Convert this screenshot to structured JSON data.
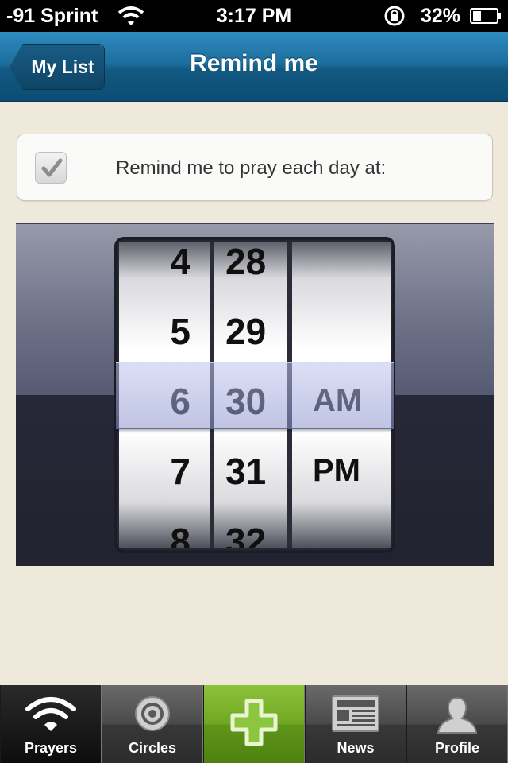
{
  "status_bar": {
    "carrier": "-91 Sprint",
    "time": "3:17 PM",
    "battery_percent": "32%",
    "icons": [
      "wifi-icon",
      "rotation-lock-icon",
      "battery-icon"
    ]
  },
  "nav": {
    "back_label": "My List",
    "title": "Remind me"
  },
  "reminder": {
    "checked": true,
    "label": "Remind me to pray each day at:"
  },
  "picker": {
    "hours": [
      "4",
      "5",
      "6",
      "7",
      "8"
    ],
    "minutes": [
      "28",
      "29",
      "30",
      "31",
      "32"
    ],
    "ampm": [
      "AM",
      "PM"
    ],
    "selected": {
      "hour": "6",
      "minute": "30",
      "ampm": "AM"
    }
  },
  "tab_bar": {
    "tabs": [
      {
        "label": "Prayers",
        "icon": "wifi-signal-icon",
        "active": true
      },
      {
        "label": "Circles",
        "icon": "target-icon",
        "active": false
      },
      {
        "label": "",
        "icon": "plus-icon",
        "active": false
      },
      {
        "label": "News",
        "icon": "newspaper-icon",
        "active": false
      },
      {
        "label": "Profile",
        "icon": "person-icon",
        "active": false
      }
    ]
  },
  "colors": {
    "nav_blue": "#1d6f9f",
    "page_background": "#efe9dc",
    "add_tab_green": "#70a722"
  }
}
